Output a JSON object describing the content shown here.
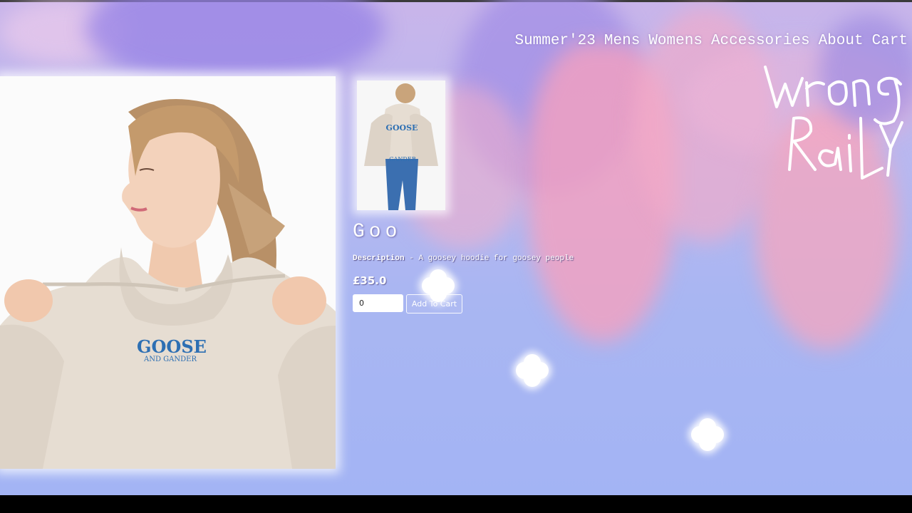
{
  "nav": {
    "items": [
      {
        "label": "Summer'23"
      },
      {
        "label": "Mens"
      },
      {
        "label": "Womens"
      },
      {
        "label": "Accessories"
      },
      {
        "label": "About"
      },
      {
        "label": "Cart"
      }
    ]
  },
  "logo": {
    "text": "wrong Rail",
    "icon": "wrong-rail-logo"
  },
  "product": {
    "title": "Goo",
    "description_label": "Description",
    "description_separator": " - ",
    "description_text": "A goosey hoodie for goosey people",
    "price": "£35.0",
    "quantity_value": "0",
    "add_to_cart_label": "Add To Cart",
    "main_image_print": "GOOSE",
    "main_image_print_sub": "AND GANDER",
    "thumb_print": "GOOSE",
    "thumb_print_sub": "GANDER"
  },
  "colors": {
    "sky": "#a9b6f2",
    "blossom": "#f6a0be",
    "hoodie": "#e6ddd2",
    "print_blue": "#2d6fb3"
  }
}
